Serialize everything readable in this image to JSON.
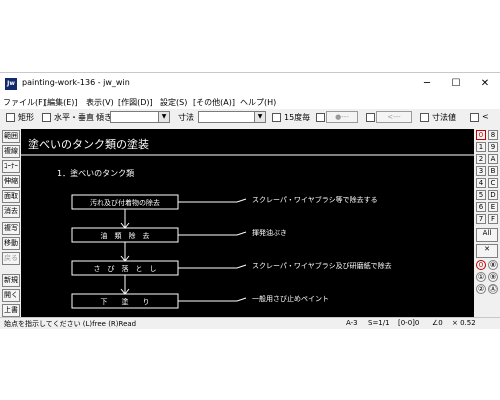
{
  "window": {
    "title": "painting-work-136 - jw_win",
    "app_icon": "Jw",
    "controls": {
      "minimize": "─",
      "maximize": "☐",
      "close": "✕"
    }
  },
  "menu": [
    "ファイル(F)",
    "[編集(E)]",
    "表示(V)",
    "[作図(D)]",
    "設定(S)",
    "[その他(A)]",
    "ヘルプ(H)"
  ],
  "toolbar": {
    "rect_label": "矩形",
    "horiz_vert_label": "水平・垂直",
    "slope_label": "傾き",
    "dimension_label": "寸法",
    "degree_label": "15度毎",
    "btn_circle": "●---",
    "btn_arrow": "<---",
    "dim_value_label": "寸法値",
    "lt_label": "<"
  },
  "left_tools": [
    "範囲",
    "複線",
    "ｺｰﾅｰ",
    "伸縮",
    "面取",
    "消去",
    "複写",
    "移動",
    "戻る",
    "新規",
    "開く",
    "上書"
  ],
  "right_tools": [
    "0",
    "8",
    "1",
    "9",
    "2",
    "A",
    "3",
    "B",
    "4",
    "C",
    "5",
    "D",
    "6",
    "E",
    "7",
    "F",
    "All",
    "✕",
    "0",
    "⑧",
    "①",
    "⑨",
    "②",
    "Ⓐ"
  ],
  "drawing": {
    "title": "塗べいのタンク類の塗装",
    "subtitle": "1．塗べいのタンク類",
    "steps": [
      {
        "box": "汚れ及び付着物の除去",
        "note": "スクレーパ・ワイヤブラシ等で除去する"
      },
      {
        "box": "油　類　除　去",
        "note": "揮発油ぶき"
      },
      {
        "box": "さ　び　落　と　し",
        "note": "スクレーパ・ワイヤブラシ及び研磨紙で除去"
      },
      {
        "box": "下　　塗　　り",
        "note": "一般用さび止めペイント"
      }
    ]
  },
  "status": {
    "message": "始点を指示してください (L)free (R)Read",
    "paper": "A-3",
    "scale": "S=1/1",
    "layer": "[0-0]0",
    "angle": "∠0",
    "zoom": "× 0.52"
  }
}
